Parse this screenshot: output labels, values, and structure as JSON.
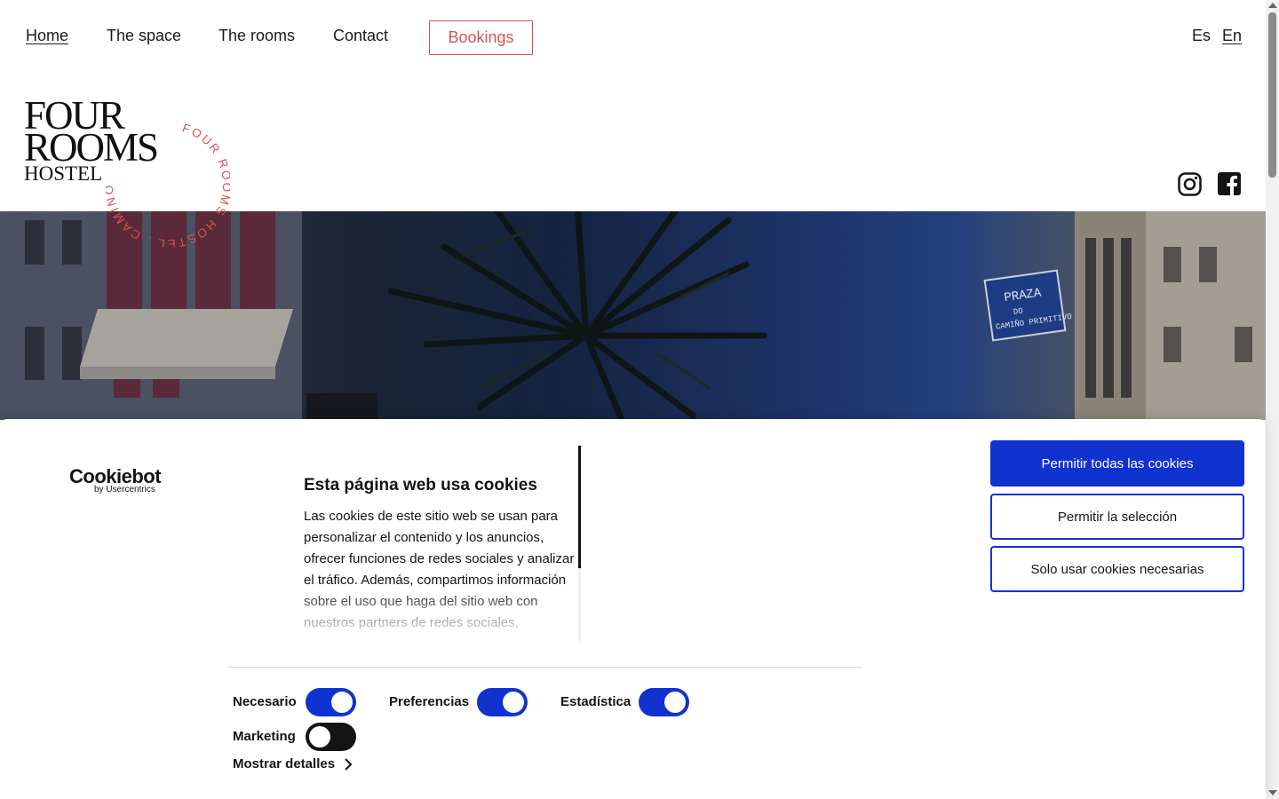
{
  "nav": {
    "items": [
      {
        "label": "Home"
      },
      {
        "label": "The space"
      },
      {
        "label": "The rooms"
      },
      {
        "label": "Contact"
      }
    ],
    "booking_label": "Bookings",
    "languages": [
      "Es",
      "En"
    ]
  },
  "logo": {
    "line1": "FOUR",
    "line2": "ROOMS",
    "line3": "HOSTEL",
    "stamp_text": "FOUR ROOMS HOSTEL . CAMINO PRIMITIVO"
  },
  "social": [
    "instagram-icon",
    "facebook-icon"
  ],
  "hero": {
    "sign_text": "PRAZA DO CAMIÑO PRIMITIVO"
  },
  "cookie": {
    "brand": "Cookiebot",
    "brand_sub": "by Usercentrics",
    "title": "Esta página web usa cookies",
    "body": "Las cookies de este sitio web se usan para personalizar el contenido y los anuncios, ofrecer funciones de redes sociales y analizar el tráfico. Además, compartimos información sobre el uso que haga del sitio web con nuestros partners de redes sociales, publicidad y análisis web.",
    "buttons": {
      "allow_all": "Permitir todas las cookies",
      "allow_selection": "Permitir la selección",
      "necessary_only": "Solo usar cookies necesarias"
    },
    "toggles": [
      {
        "label": "Necesario",
        "on": true
      },
      {
        "label": "Preferencias",
        "on": true
      },
      {
        "label": "Estadística",
        "on": true
      },
      {
        "label": "Marketing",
        "on": false
      }
    ],
    "details_label": "Mostrar detalles"
  },
  "colors": {
    "accent": "#1032cf",
    "brand_red": "#d9534f"
  }
}
